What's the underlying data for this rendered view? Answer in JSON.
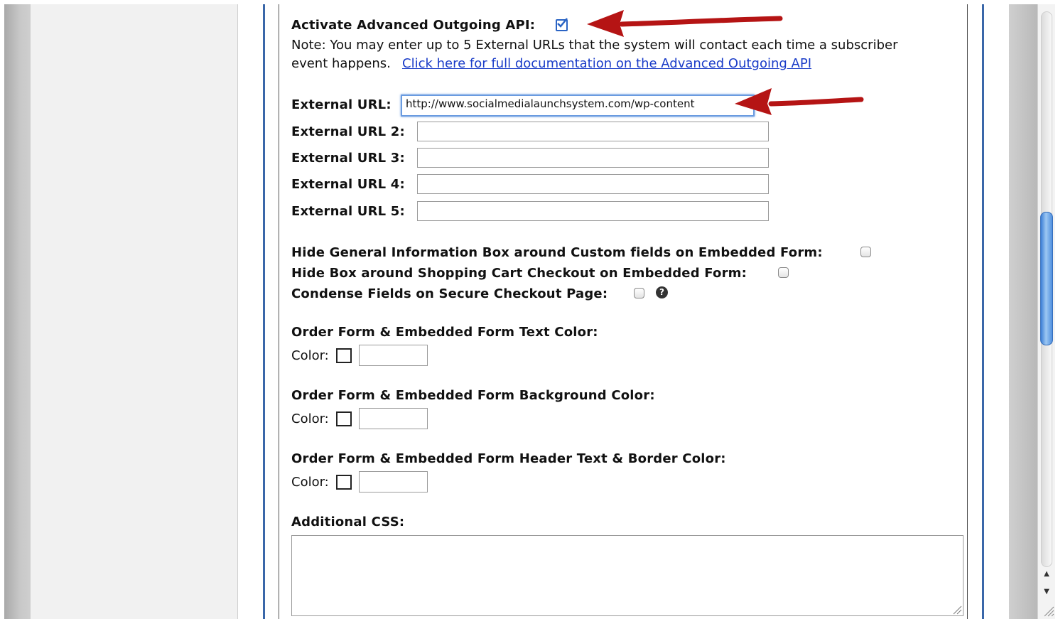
{
  "api": {
    "activate_label": "Activate Advanced Outgoing API:",
    "activate_checked": true,
    "note_line1": "Note: You may enter up to 5 External URLs that the system will contact each time a subscriber",
    "note_line2": "event happens.",
    "doc_link": "Click here for full documentation on the Advanced Outgoing API"
  },
  "urls": [
    {
      "label": "External URL:",
      "value": "http://www.socialmedialaunchsystem.com/wp-content"
    },
    {
      "label": "External URL 2:",
      "value": ""
    },
    {
      "label": "External URL 3:",
      "value": ""
    },
    {
      "label": "External URL 4:",
      "value": ""
    },
    {
      "label": "External URL 5:",
      "value": ""
    }
  ],
  "options": [
    {
      "label": "Hide General Information Box around Custom fields on Embedded Form:",
      "checked": false
    },
    {
      "label": "Hide Box around Shopping Cart Checkout on Embedded Form:",
      "checked": false
    },
    {
      "label": "Condense Fields on Secure Checkout Page:",
      "checked": false
    }
  ],
  "help_icon": "?",
  "colors": [
    {
      "title": "Order Form & Embedded Form Text Color:",
      "color_label": "Color:",
      "value": ""
    },
    {
      "title": "Order Form & Embedded Form Background Color:",
      "color_label": "Color:",
      "value": ""
    },
    {
      "title": "Order Form & Embedded Form Header Text & Border Color:",
      "color_label": "Color:",
      "value": ""
    }
  ],
  "css": {
    "label": "Additional CSS:",
    "value": ""
  },
  "scroll": {
    "up": "▲",
    "down": "▼"
  },
  "accent": "#2b64c4",
  "annotation_color": "#b51414"
}
